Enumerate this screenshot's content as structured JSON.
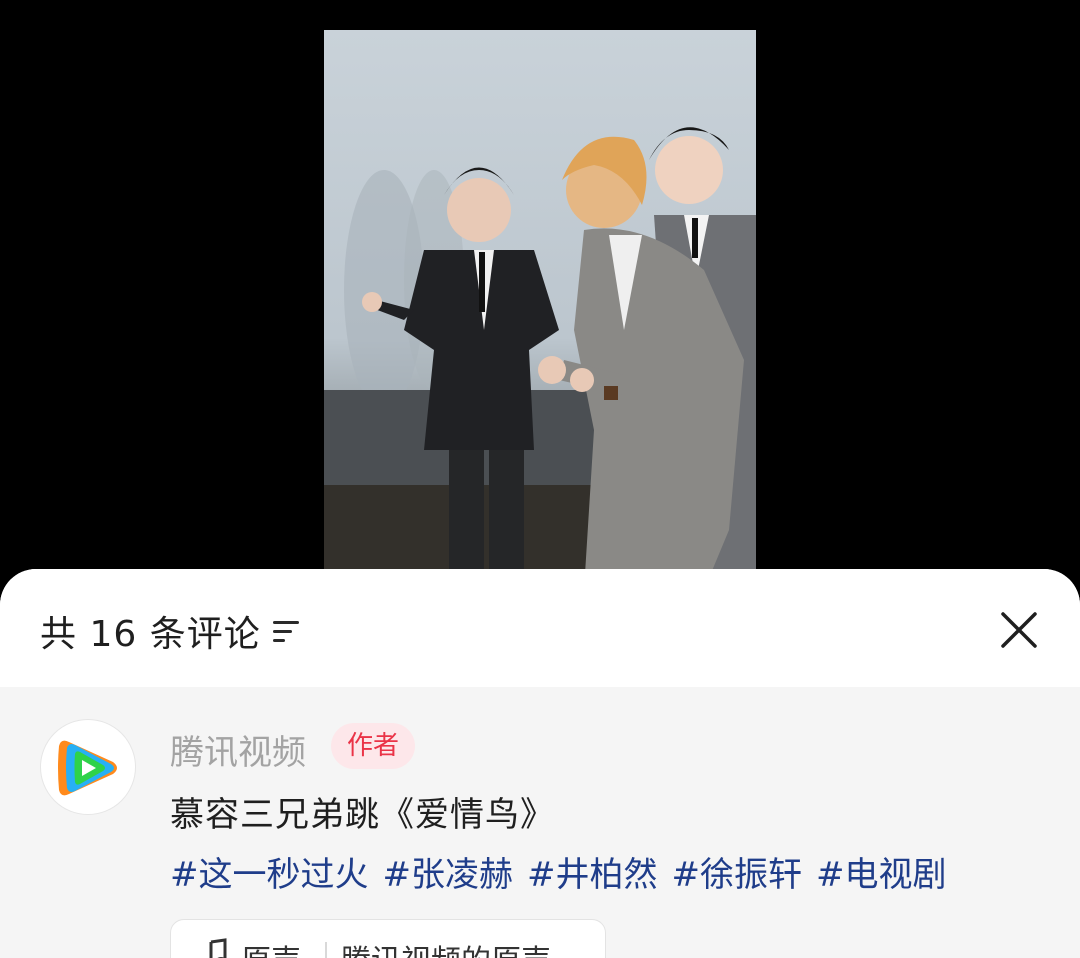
{
  "comments_panel": {
    "count_label": "共 16 条评论",
    "sort_icon": "sort-lines-icon",
    "close_icon": "close-x-icon"
  },
  "post": {
    "username": "腾讯视频",
    "author_badge": "作者",
    "avatar_icon": "tencent-video-logo-icon",
    "text": "慕容三兄弟跳《爱情鸟》",
    "hashtags": [
      "#这一秒过火",
      "#张凌赫",
      "#井柏然",
      "#徐振轩",
      "#电视剧"
    ],
    "sound": {
      "icon": "music-note-icon",
      "label": "原声",
      "source": "腾讯视频的原声"
    }
  },
  "colors": {
    "sheet_bg": "#ffffff",
    "body_bg": "#f5f5f5",
    "hashtag": "#1f3d8a",
    "badge_text": "#ea3347",
    "badge_bg": "#fde7ea"
  }
}
